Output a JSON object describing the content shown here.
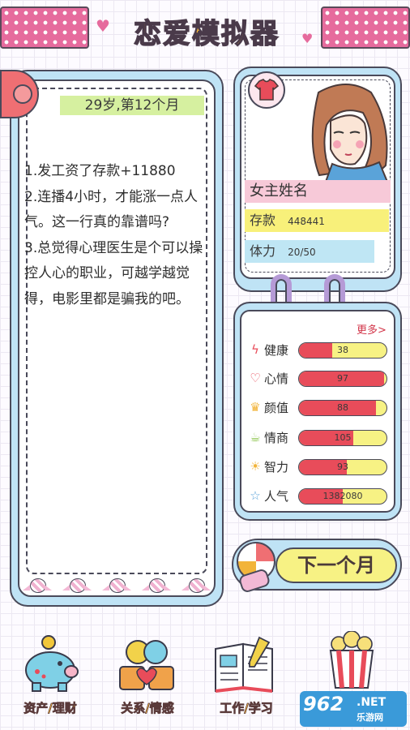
{
  "header": {
    "title": "恋爱模拟器"
  },
  "story": {
    "age_label": "29岁,第12个月",
    "lines": [
      "1.发工资了存款+11880",
      "2.连播4小时，才能涨一点人气。这一行真的靠谱吗?",
      "3.总觉得心理医生是个可以操控人心的职业，可越学越觉得，电影里都是骗我的吧。"
    ]
  },
  "profile": {
    "name": "女主姓名",
    "savings_label": "存款",
    "savings_value": "448441",
    "stamina_label": "体力",
    "stamina_value": "20/50"
  },
  "stats": {
    "more_label": "更多>",
    "rows": [
      {
        "icon": "lightning-icon",
        "label": "健康",
        "value": "38",
        "fill": 0.38,
        "color": "#e84c5a"
      },
      {
        "icon": "heart-outline-icon",
        "label": "心情",
        "value": "97",
        "fill": 0.97,
        "color": "#e84c5a"
      },
      {
        "icon": "crown-icon",
        "label": "颜值",
        "value": "88",
        "fill": 0.88,
        "color": "#e84c5a"
      },
      {
        "icon": "cup-icon",
        "label": "情商",
        "value": "105",
        "fill": 0.62,
        "color": "#e84c5a"
      },
      {
        "icon": "bulb-icon",
        "label": "智力",
        "value": "93",
        "fill": 0.55,
        "color": "#e84c5a"
      },
      {
        "icon": "star-icon",
        "label": "人气",
        "value": "1382080",
        "fill": 0.5,
        "color": "#e84c5a"
      }
    ]
  },
  "next_month": {
    "label": "下一个月"
  },
  "nav": [
    {
      "label": "资产/理财",
      "icon": "piggy-bank-icon"
    },
    {
      "label": "关系/情感",
      "icon": "heart-cups-icon"
    },
    {
      "label": "工作/学习",
      "icon": "notebook-icon"
    },
    {
      "label": "",
      "icon": "popcorn-icon"
    }
  ],
  "watermark": {
    "num": "962",
    "net": ".NET",
    "sub": "乐游网"
  },
  "colors": {
    "pink": "#e66b9d",
    "yellow": "#f2b43a",
    "blue": "#bfe3f5",
    "red": "#e84c5a"
  }
}
